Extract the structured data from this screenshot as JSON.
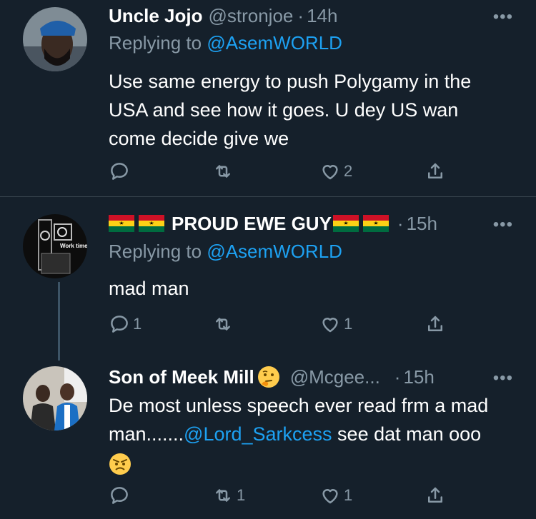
{
  "tweets": [
    {
      "name": "Uncle Jojo",
      "handle": "@stronjoe",
      "time": "14h",
      "reply_prefix": "Replying to",
      "reply_to": "@AsemWORLD",
      "text": "Use same energy to push Polygamy in the USA and see how it goes. U dey US wan come decide give we",
      "reply_count": "",
      "retweet_count": "",
      "like_count": "2"
    },
    {
      "name": "PROUD EWE GUY",
      "handle": "",
      "time": "15h",
      "reply_prefix": "Replying to",
      "reply_to": "@AsemWORLD",
      "text": "mad man",
      "avatar_text": "Work time",
      "reply_count": "1",
      "retweet_count": "",
      "like_count": "1"
    },
    {
      "name": "Son of Meek Mill",
      "handle": "@Mcgee...",
      "time": "15h",
      "text_part1": "De most unless speech ever read frm a mad man.......",
      "mention": "@Lord_Sarkcess",
      "text_part2": " see dat man ooo",
      "reply_count": "",
      "retweet_count": "1",
      "like_count": "1"
    }
  ],
  "colors": {
    "background": "#15202b",
    "secondary": "#8899a6",
    "link": "#1da1f2",
    "divider": "#38444d"
  },
  "icons": [
    "reply-icon",
    "retweet-icon",
    "like-icon",
    "share-icon",
    "more-icon",
    "ghana-flag-icon",
    "thinking-face-emoji",
    "angry-face-emoji"
  ]
}
